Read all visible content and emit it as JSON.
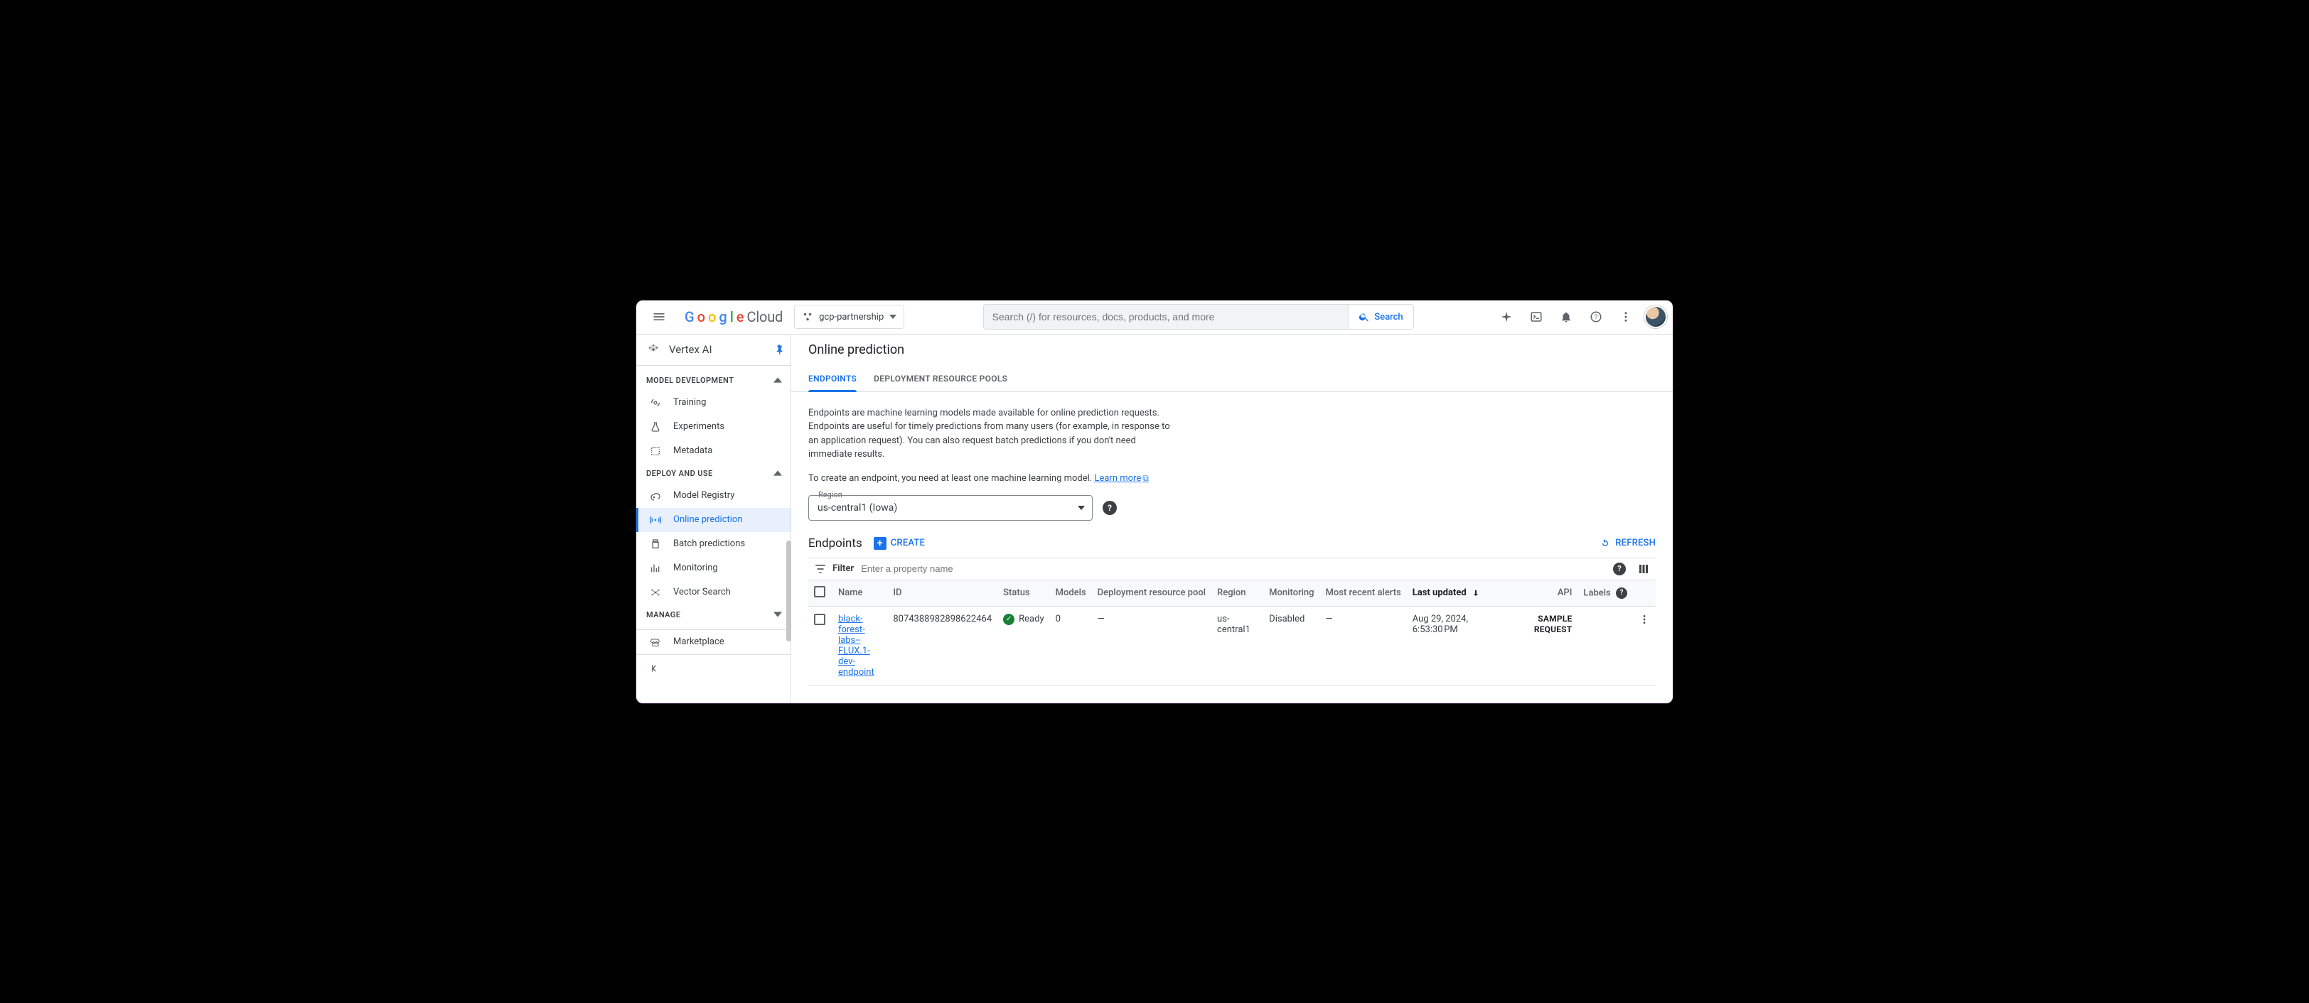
{
  "header": {
    "project": "gcp-partnership",
    "search_placeholder": "Search (/) for resources, docs, products, and more",
    "search_button": "Search"
  },
  "product": "Vertex AI",
  "sidebar": {
    "sections": [
      {
        "title": "MODEL DEVELOPMENT",
        "items": [
          {
            "label": "Training"
          },
          {
            "label": "Experiments"
          },
          {
            "label": "Metadata"
          }
        ]
      },
      {
        "title": "DEPLOY AND USE",
        "items": [
          {
            "label": "Model Registry"
          },
          {
            "label": "Online prediction",
            "selected": true
          },
          {
            "label": "Batch predictions"
          },
          {
            "label": "Monitoring"
          },
          {
            "label": "Vector Search"
          }
        ]
      },
      {
        "title": "MANAGE",
        "items": [
          {
            "label": "Marketplace"
          }
        ]
      }
    ]
  },
  "page": {
    "title": "Online prediction",
    "tabs": [
      {
        "label": "ENDPOINTS",
        "active": true
      },
      {
        "label": "DEPLOYMENT RESOURCE POOLS"
      }
    ],
    "description": "Endpoints are machine learning models made available for online prediction requests. Endpoints are useful for timely predictions from many users (for example, in response to an application request). You can also request batch predictions if you don't need immediate results.",
    "create_hint_prefix": "To create an endpoint, you need at least one machine learning model. ",
    "learn_more": "Learn more",
    "region_label": "Region",
    "region_value": "us-central1 (Iowa)",
    "section_title": "Endpoints",
    "create_button": "CREATE",
    "refresh_button": "REFRESH",
    "filter_label": "Filter",
    "filter_placeholder": "Enter a property name",
    "columns": [
      "Name",
      "ID",
      "Status",
      "Models",
      "Deployment resource pool",
      "Region",
      "Monitoring",
      "Most recent alerts",
      "Last updated",
      "API",
      "Labels"
    ],
    "sort_column": "Last updated",
    "rows": [
      {
        "name": "black-forest-labs--FLUX.1-dev-endpoint",
        "id": "8074388982898622464",
        "status": "Ready",
        "models": "0",
        "pool": "—",
        "region": "us-central1",
        "monitoring": "Disabled",
        "alerts": "—",
        "last_updated": "Aug 29, 2024, 6:53:30 PM",
        "api": "SAMPLE REQUEST",
        "labels": ""
      }
    ]
  }
}
